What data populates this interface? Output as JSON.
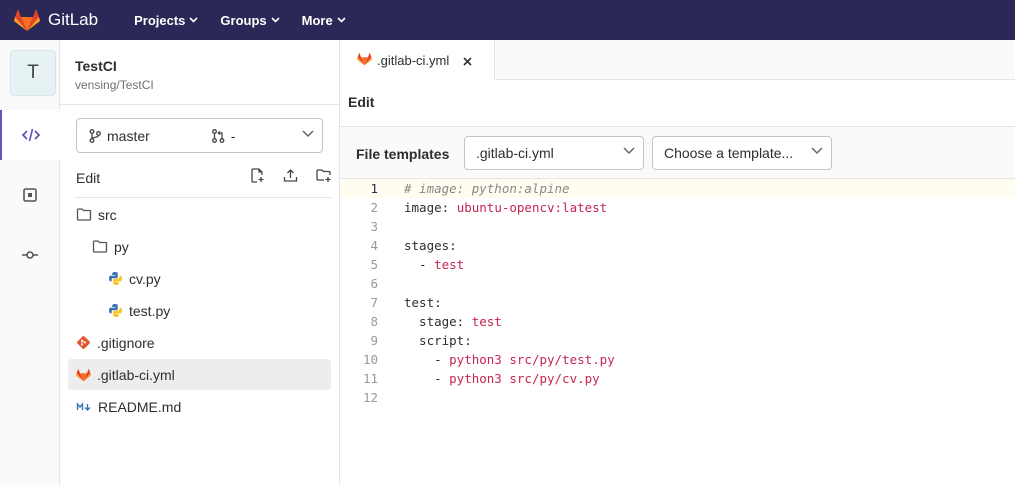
{
  "topbar": {
    "brand": "GitLab",
    "nav": [
      {
        "label": "Projects"
      },
      {
        "label": "Groups"
      },
      {
        "label": "More"
      }
    ]
  },
  "project": {
    "avatar_letter": "T",
    "name": "TestCI",
    "path": "vensing/TestCI"
  },
  "branch": {
    "name": "master",
    "merge_request": "-"
  },
  "sidebar": {
    "edit_label": "Edit",
    "tree": [
      {
        "label": "src",
        "icon": "folder-icon"
      },
      {
        "label": "py",
        "icon": "folder-icon"
      },
      {
        "label": "cv.py",
        "icon": "python-icon"
      },
      {
        "label": "test.py",
        "icon": "python-icon"
      },
      {
        "label": ".gitignore",
        "icon": "git-icon"
      },
      {
        "label": ".gitlab-ci.yml",
        "icon": "gitlab-icon"
      },
      {
        "label": "README.md",
        "icon": "markdown-icon"
      }
    ]
  },
  "editor": {
    "tab_label": ".gitlab-ci.yml",
    "mode_tab": "Edit",
    "templates_label": "File templates",
    "template_type": ".gitlab-ci.yml",
    "template_choice": "Choose a template...",
    "lines": [
      {
        "num": "1",
        "comment": "# image: python:alpine"
      },
      {
        "num": "2",
        "key": "image: ",
        "val": "ubuntu-opencv:latest"
      },
      {
        "num": "3"
      },
      {
        "num": "4",
        "key": "stages:"
      },
      {
        "num": "5",
        "key": "  - ",
        "val": "test"
      },
      {
        "num": "6"
      },
      {
        "num": "7",
        "key": "test:"
      },
      {
        "num": "8",
        "key": "  stage: ",
        "val": "test"
      },
      {
        "num": "9",
        "key": "  script:"
      },
      {
        "num": "10",
        "key": "    - ",
        "val": "python3 src/py/test.py"
      },
      {
        "num": "11",
        "key": "    - ",
        "val": "python3 src/py/cv.py"
      },
      {
        "num": "12"
      }
    ]
  },
  "colors": {
    "nav_bg": "#2b2757",
    "accent": "#6b4fbb",
    "yaml_value": "#c7254e"
  }
}
